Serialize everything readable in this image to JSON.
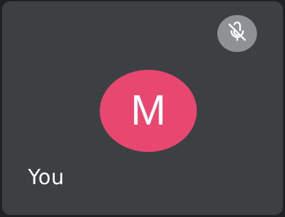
{
  "participant": {
    "initial": "M",
    "name": "You",
    "avatar_color": "#e8486f",
    "mic_state": "muted",
    "mic_icon": "mic-off-icon"
  },
  "colors": {
    "tile_background": "#3c4043",
    "page_background": "#202124",
    "mic_badge_background": "#8e9296",
    "text": "#ffffff"
  }
}
